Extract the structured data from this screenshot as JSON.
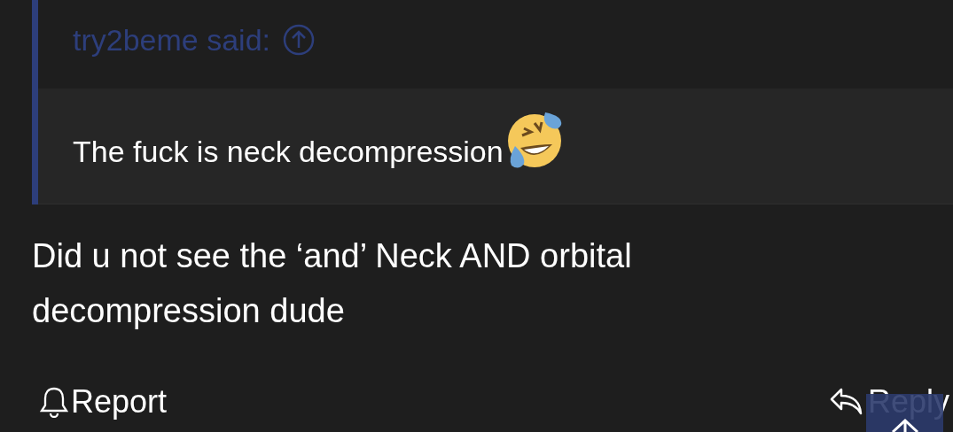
{
  "quote": {
    "author_line": "try2beme said:",
    "text": "The fuck is neck decompression"
  },
  "post": {
    "text": "Did u not see the ‘and’ Neck AND orbital decompression dude"
  },
  "actions": {
    "report": "Report",
    "reply": "Reply"
  }
}
